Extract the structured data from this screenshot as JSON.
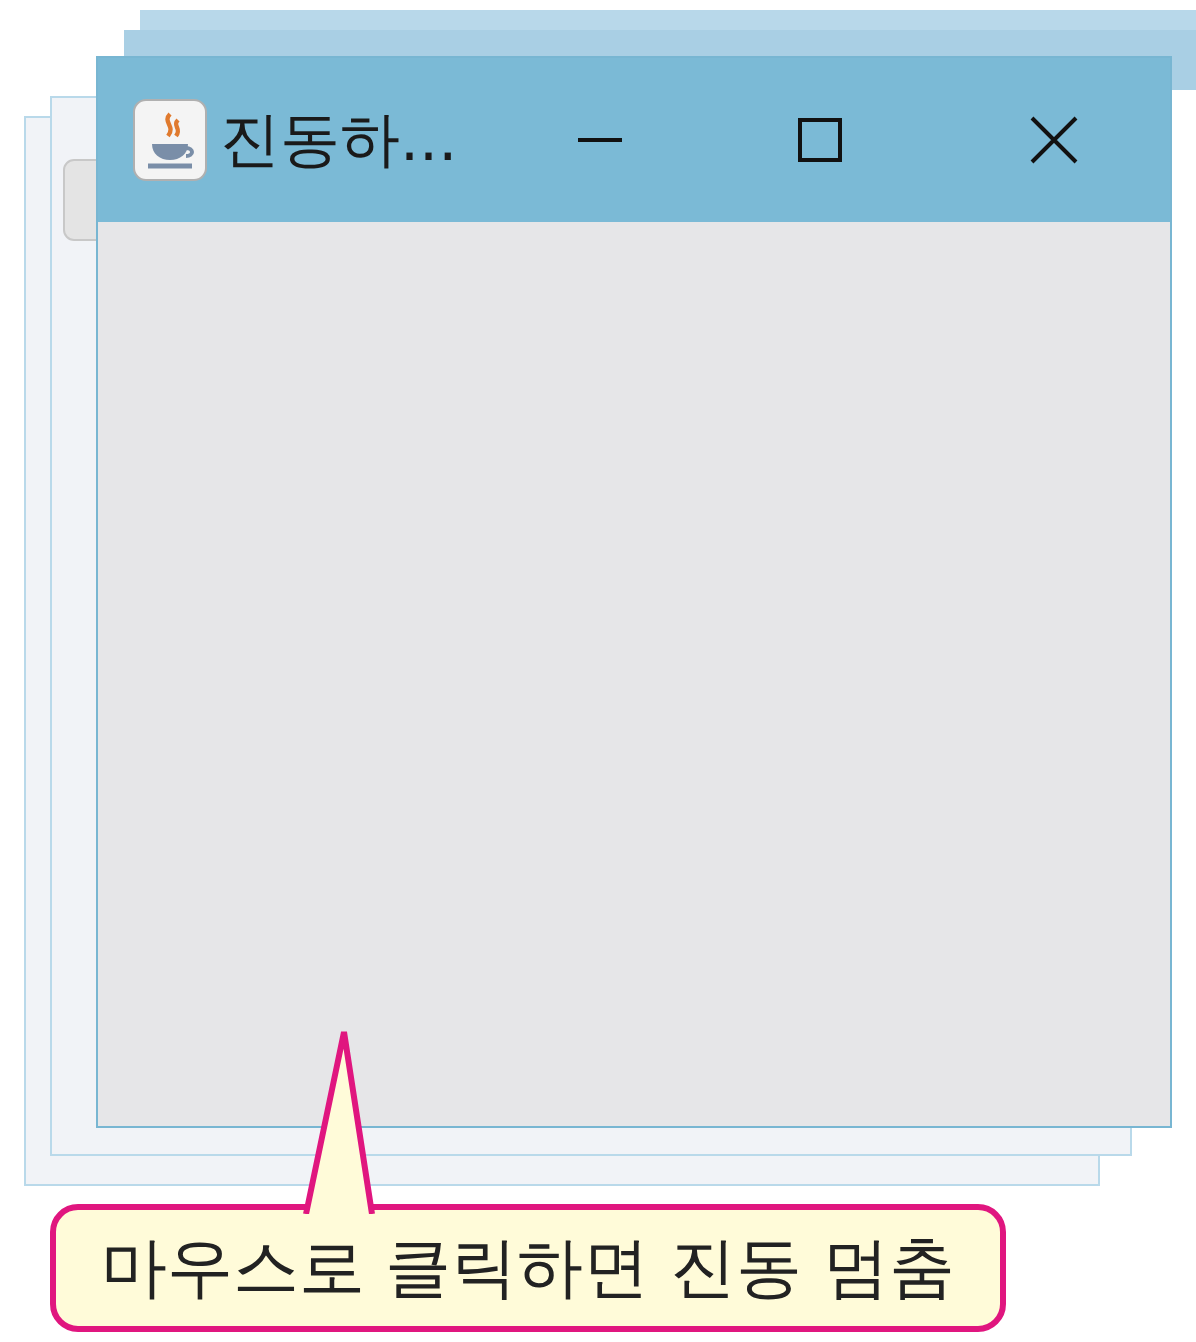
{
  "window": {
    "title": "진동하..."
  },
  "callout": {
    "text": "마우스로 클릭하면 진동 멈춤"
  }
}
